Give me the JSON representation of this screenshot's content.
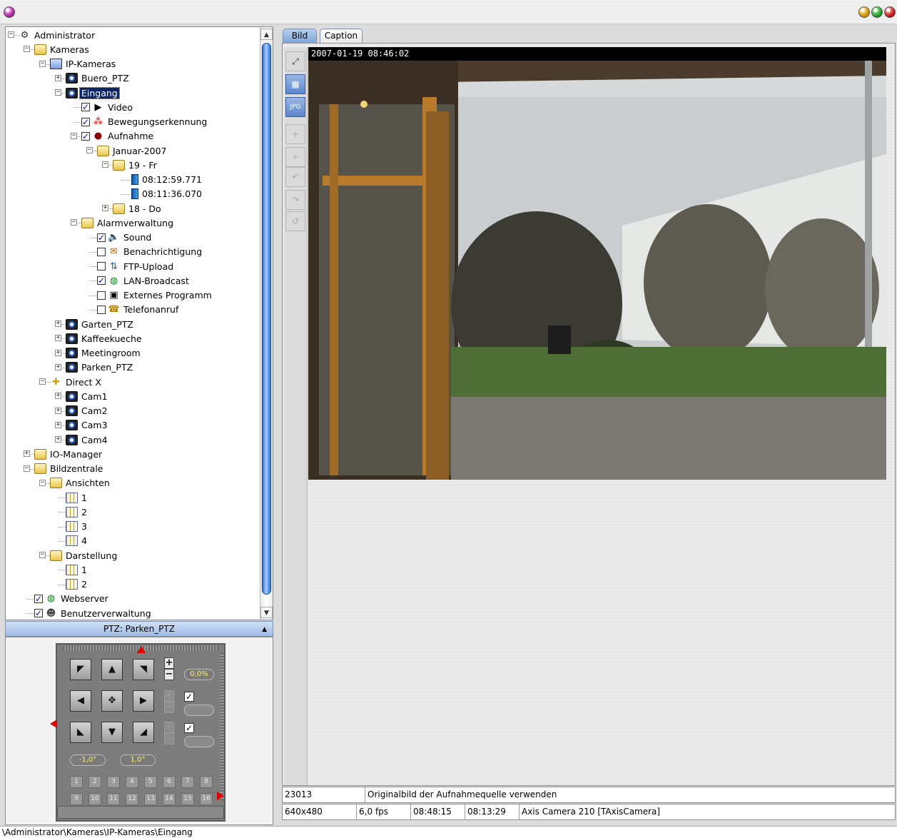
{
  "window": {
    "title": ""
  },
  "tree": {
    "items": [
      {
        "label": "Administrator",
        "icon": "admin-icon"
      },
      {
        "label": "Kameras",
        "icon": "folder-open-icon"
      },
      {
        "label": "IP-Kameras",
        "icon": "network-camera-icon"
      },
      {
        "label": "Buero_PTZ",
        "icon": "camera-icon"
      },
      {
        "label": "Eingang",
        "icon": "camera-icon",
        "selected": true
      },
      {
        "label": "Video",
        "icon": "play-icon",
        "checked": true
      },
      {
        "label": "Bewegungserkennung",
        "icon": "motion-icon",
        "checked": true
      },
      {
        "label": "Aufnahme",
        "icon": "record-icon",
        "checked": true
      },
      {
        "label": "Januar-2007",
        "icon": "folder-open-icon"
      },
      {
        "label": "19 - Fr",
        "icon": "folder-open-icon"
      },
      {
        "label": "08:12:59.771",
        "icon": "recording-file-icon"
      },
      {
        "label": "08:11:36.070",
        "icon": "recording-file-icon"
      },
      {
        "label": "18 - Do",
        "icon": "folder-icon"
      },
      {
        "label": "Alarmverwaltung",
        "icon": "folder-open-icon"
      },
      {
        "label": "Sound",
        "icon": "speaker-icon",
        "checked": true
      },
      {
        "label": "Benachrichtigung",
        "icon": "notification-icon",
        "checked": false
      },
      {
        "label": "FTP-Upload",
        "icon": "ftp-icon",
        "checked": false
      },
      {
        "label": "LAN-Broadcast",
        "icon": "globe-icon",
        "checked": true
      },
      {
        "label": "Externes Programm",
        "icon": "terminal-icon",
        "checked": false
      },
      {
        "label": "Telefonanruf",
        "icon": "phone-icon",
        "checked": false
      },
      {
        "label": "Garten_PTZ",
        "icon": "camera-icon"
      },
      {
        "label": "Kaffeekueche",
        "icon": "camera-icon"
      },
      {
        "label": "Meetingroom",
        "icon": "camera-icon"
      },
      {
        "label": "Parken_PTZ",
        "icon": "camera-icon"
      },
      {
        "label": "Direct X",
        "icon": "directx-icon"
      },
      {
        "label": "Cam1",
        "icon": "camera-icon"
      },
      {
        "label": "Cam2",
        "icon": "camera-icon"
      },
      {
        "label": "Cam3",
        "icon": "camera-icon"
      },
      {
        "label": "Cam4",
        "icon": "camera-icon"
      },
      {
        "label": "IO-Manager",
        "icon": "folder-icon"
      },
      {
        "label": "Bildzentrale",
        "icon": "folder-open-icon"
      },
      {
        "label": "Ansichten",
        "icon": "folder-open-icon"
      },
      {
        "label": "1",
        "icon": "view-grid-icon"
      },
      {
        "label": "2",
        "icon": "view-grid-icon"
      },
      {
        "label": "3",
        "icon": "view-grid-icon"
      },
      {
        "label": "4",
        "icon": "view-grid-icon"
      },
      {
        "label": "Darstellung",
        "icon": "folder-open-icon"
      },
      {
        "label": "1",
        "icon": "layout-icon"
      },
      {
        "label": "2",
        "icon": "layout-icon"
      },
      {
        "label": "Webserver",
        "icon": "globe-icon",
        "checked": true
      },
      {
        "label": "Benutzerverwaltung",
        "icon": "users-icon",
        "checked": true
      }
    ]
  },
  "ptz": {
    "header": "PTZ: Parken_PTZ",
    "zoom_value": "0,0%",
    "left_value": "-1,0°",
    "right_value": "1,0°",
    "presets": [
      "1",
      "2",
      "3",
      "4",
      "5",
      "6",
      "7",
      "8",
      "9",
      "10",
      "11",
      "12",
      "13",
      "14",
      "15",
      "16"
    ]
  },
  "tabs": {
    "bild": "Bild",
    "caption": "Caption"
  },
  "video": {
    "timestamp": "2007-01-19 08:46:02"
  },
  "status": {
    "row1": {
      "id": "23013",
      "message": "Originalbild der Aufnahmequelle verwenden"
    },
    "row2": {
      "resolution": "640x480",
      "fps": "6,0 fps",
      "time1": "08:48:15",
      "time2": "08:13:29",
      "camera": "Axis Camera 210 [TAxisCamera]"
    }
  },
  "path": "\\Administrator\\Kameras\\IP-Kameras\\Eingang",
  "colors": {
    "accent": "#0a246a",
    "tab_active": "#7ea3d8",
    "ptz_value": "#fff26a"
  }
}
